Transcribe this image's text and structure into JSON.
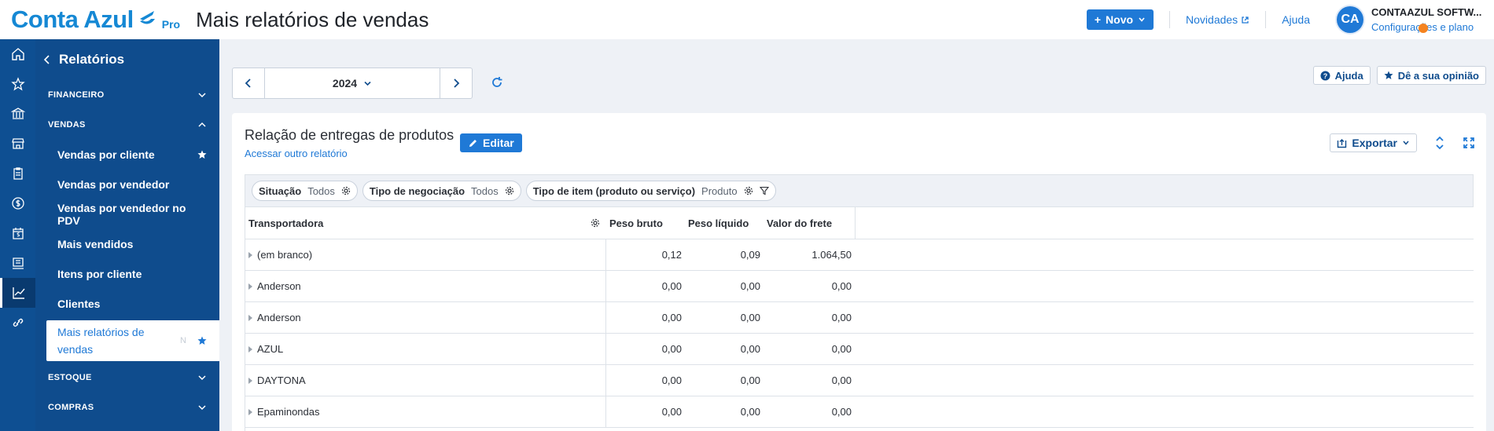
{
  "header": {
    "logo_text": "Conta Azul",
    "logo_badge": "Pro",
    "page_title": "Mais relatórios de vendas",
    "new_button": "Novo",
    "news_link": "Novidades",
    "help_link": "Ajuda",
    "avatar_initials": "CA",
    "account_name": "CONTAAZUL SOFTW...",
    "account_plan_link": "Configurações e plano"
  },
  "rail": {
    "icons": [
      "home-icon",
      "star-icon",
      "bank-icon",
      "store-icon",
      "clipboard-icon",
      "dollar-icon",
      "calendar-dollar-icon",
      "receipt-icon",
      "chart-line-icon",
      "link-icon"
    ],
    "active": "chart-line-icon"
  },
  "sidebar": {
    "back_label": "Relatórios",
    "groups": {
      "financeiro": "FINANCEIRO",
      "vendas": "VENDAS",
      "estoque": "ESTOQUE",
      "compras": "COMPRAS"
    },
    "vendas_items": [
      {
        "label": "Vendas por cliente",
        "starred": true
      },
      {
        "label": "Vendas por vendedor",
        "starred": false
      },
      {
        "label": "Vendas por vendedor no PDV",
        "starred": false
      },
      {
        "label": "Mais vendidos",
        "starred": false
      },
      {
        "label": "Itens por cliente",
        "starred": false
      },
      {
        "label": "Clientes",
        "starred": false
      },
      {
        "label": "Mais relatórios de vendas",
        "starred": true,
        "active": true,
        "badge": "N"
      }
    ]
  },
  "period": {
    "year": "2024"
  },
  "actions": {
    "help": "Ajuda",
    "feedback": "Dê a sua opinião"
  },
  "report": {
    "title": "Relação de entregas de produtos",
    "other_report_link": "Acessar outro relatório",
    "edit_button": "Editar",
    "export_button": "Exportar"
  },
  "filters": [
    {
      "label": "Situação",
      "value": "Todos"
    },
    {
      "label": "Tipo de negociação",
      "value": "Todos"
    },
    {
      "label": "Tipo de item (produto ou serviço)",
      "value": "Produto"
    }
  ],
  "table": {
    "columns": [
      "Transportadora",
      "Peso bruto",
      "Peso líquido",
      "Valor do frete"
    ],
    "rows": [
      [
        "(em branco)",
        "0,12",
        "0,09",
        "1.064,50"
      ],
      [
        "Anderson",
        "0,00",
        "0,00",
        "0,00"
      ],
      [
        "Anderson",
        "0,00",
        "0,00",
        "0,00"
      ],
      [
        "AZUL",
        "0,00",
        "0,00",
        "0,00"
      ],
      [
        "DAYTONA",
        "0,00",
        "0,00",
        "0,00"
      ],
      [
        "Epaminondas",
        "0,00",
        "0,00",
        "0,00"
      ]
    ]
  },
  "colors": {
    "brand": "#1588d4",
    "primary": "#1f79d6",
    "sidebar": "#0f4c8d",
    "accent_dot": "#f5831f"
  }
}
